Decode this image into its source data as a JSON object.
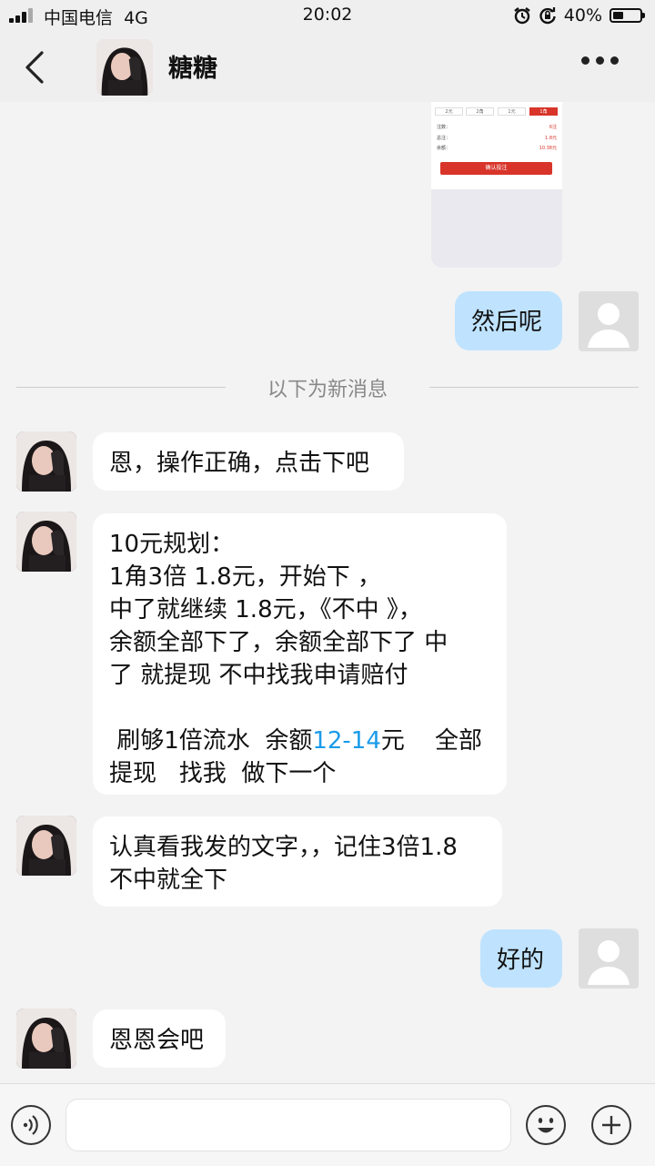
{
  "status_bar": {
    "carrier": "中国电信",
    "network": "4G",
    "time": "20:02",
    "battery_percent": "40%",
    "battery_level": 0.4
  },
  "header": {
    "contact_name": "糖糖"
  },
  "shared_image": {
    "chips": [
      "2元",
      "2角",
      "1元",
      "1角"
    ],
    "rows": [
      {
        "label": "注数：",
        "value": "6注"
      },
      {
        "label": "总注：",
        "value": "1.8元"
      },
      {
        "label": "余额：",
        "value": "10.38元"
      }
    ],
    "button": "确认投注"
  },
  "messages": {
    "m1": "然后呢",
    "divider": "以下为新消息",
    "m2": "恩，操作正确，点击下吧",
    "m3": {
      "l1": "10元规划：",
      "l2": "1角3倍 1.8元，开始下 ，",
      "l3": "中了就继续  1.8元，《不中 》，",
      "l4": "余额全部下了，余额全部下了  中",
      "l5": "了   就提现    不中找我申请赔付",
      "l6a": " 刷够1倍流水  余额",
      "l6b": "12-14",
      "l6c": "元    全部",
      "l7": "提现   找我  做下一个"
    },
    "m4": {
      "l1": "认真看我发的文字，，记住3倍1.8",
      "l2": "不中就全下"
    },
    "m5": "好的",
    "m6": "恩恩会吧"
  },
  "colors": {
    "incoming_bubble": "#ffffff",
    "outgoing_bubble": "#bfe3ff",
    "highlight": "#1a9bea",
    "background": "#f3f3f3"
  },
  "icons": [
    "signal-icon",
    "alarm-icon",
    "rotation-lock-icon",
    "battery-icon",
    "back-icon",
    "more-icon",
    "voice-icon",
    "emoji-icon",
    "plus-icon"
  ]
}
